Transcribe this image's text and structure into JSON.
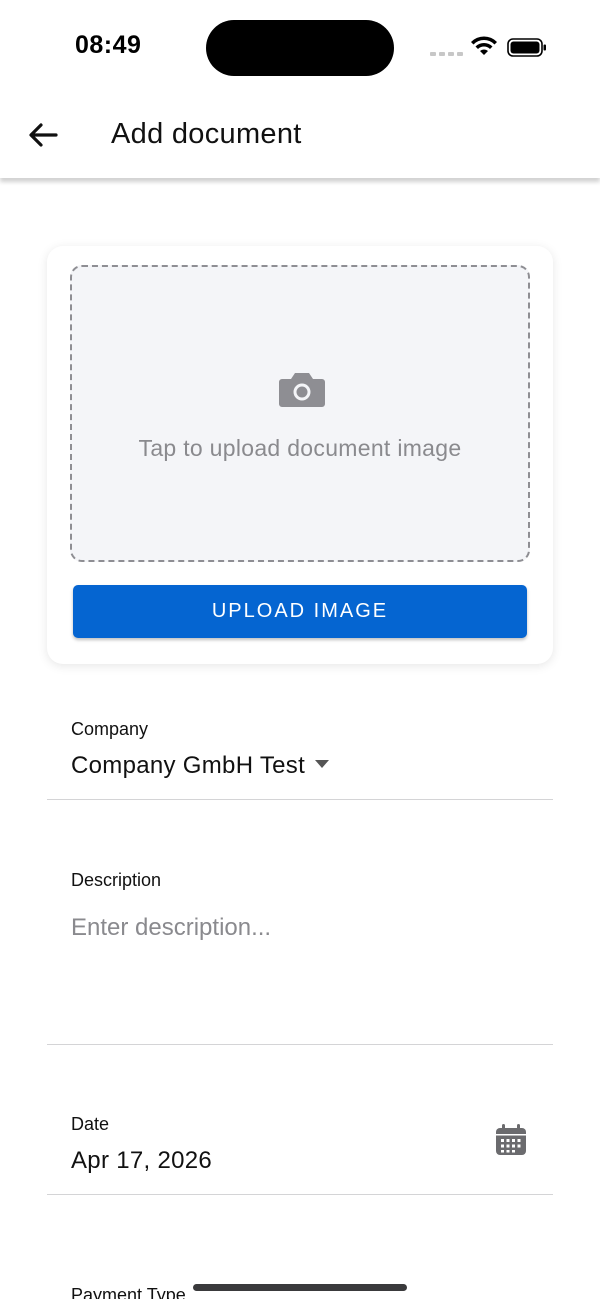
{
  "status_bar": {
    "time": "08:49"
  },
  "app_bar": {
    "title": "Add document",
    "back_icon": "arrow-back-icon"
  },
  "upload": {
    "icon": "camera-icon",
    "prompt": "Tap to upload document image",
    "button_label": "UPLOAD IMAGE",
    "button_color": "#0565d1"
  },
  "form": {
    "company": {
      "label": "Company",
      "value": "Company GmbH Test"
    },
    "description": {
      "label": "Description",
      "placeholder": "Enter description...",
      "value": ""
    },
    "date": {
      "label": "Date",
      "value": "Apr 17, 2026",
      "icon": "calendar-icon"
    },
    "payment_type": {
      "label": "Payment Type"
    }
  }
}
